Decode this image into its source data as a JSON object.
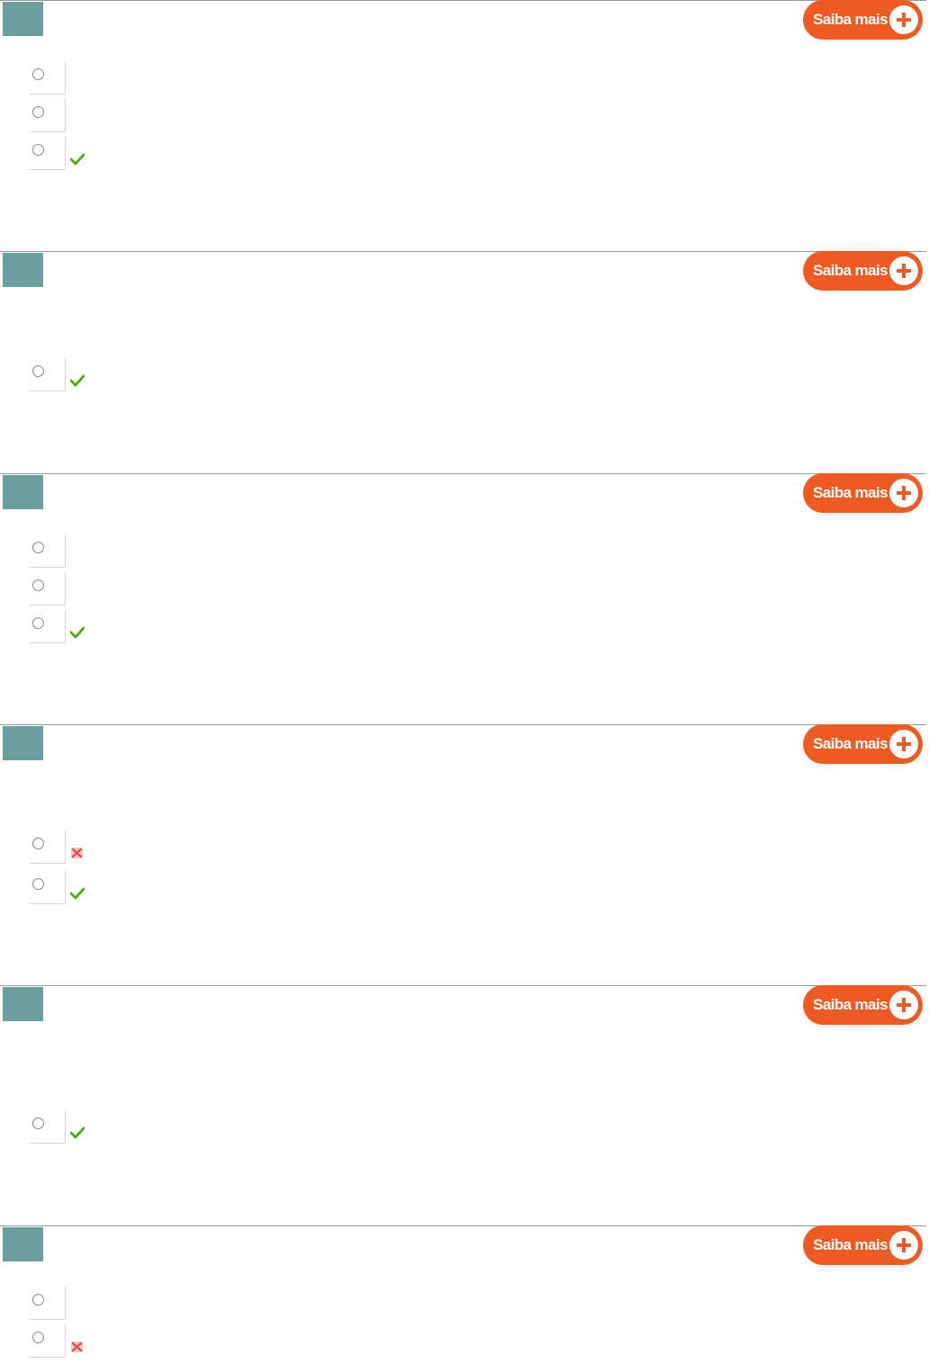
{
  "saiba_mais_label": "Saiba mais",
  "colors": {
    "question_square": "#6d9e9e",
    "button": "#ee5a24",
    "correct": "#5fbf1f",
    "wrong": "#d9534f"
  },
  "questions": [
    {
      "options": [
        {
          "mark": "none"
        },
        {
          "mark": "none"
        },
        {
          "mark": "correct-icon"
        }
      ]
    },
    {
      "options": [
        {
          "mark": "correct-icon"
        }
      ]
    },
    {
      "options": [
        {
          "mark": "none"
        },
        {
          "mark": "none"
        },
        {
          "mark": "correct-icon"
        }
      ]
    },
    {
      "options": [
        {
          "mark": "wrong-icon"
        },
        {
          "mark": "correct-icon"
        }
      ]
    },
    {
      "options": [
        {
          "mark": "correct-icon"
        }
      ]
    },
    {
      "options": [
        {
          "mark": "none"
        },
        {
          "mark": "wrong-icon"
        }
      ]
    }
  ]
}
